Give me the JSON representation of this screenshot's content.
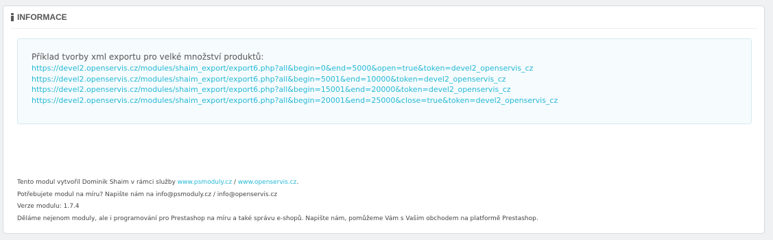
{
  "panel": {
    "heading": "INFORMACE",
    "icon": "info-icon"
  },
  "alert": {
    "title": "Příklad tvorby xml exportu pro velké množství produktů:",
    "links": [
      "https://devel2.openservis.cz/modules/shaim_export/export6.php?all&begin=0&end=5000&open=true&token=devel2_openservis_cz",
      "https://devel2.openservis.cz/modules/shaim_export/export6.php?all&begin=5001&end=10000&token=devel2_openservis_cz",
      "https://devel2.openservis.cz/modules/shaim_export/export6.php?all&begin=15001&end=20000&token=devel2_openservis_cz",
      "https://devel2.openservis.cz/modules/shaim_export/export6.php?all&begin=20001&end=25000&close=true&token=devel2_openservis_cz"
    ]
  },
  "footer": {
    "credit_prefix": "Tento modul vytvořil Dominik Shaim v rámci služby ",
    "link1": "www.psmoduly.cz",
    "separator": " / ",
    "link2": "www.openservis.cz",
    "credit_suffix": ".",
    "contact": "Potřebujete modul na míru? Napište nám na info@psmoduly.cz / info@openservis.cz",
    "version": "Verze modulu: 1.7.4",
    "promo": "Děláme nejenom moduly, ale i programování pro Prestashop na míru a také správu e-shopů. Napište nám, pomůžeme Vám s Vašim obchodem na platformě Prestashop."
  },
  "colors": {
    "link": "#25b9d7",
    "alert_bg": "#f6fbfd",
    "alert_border": "#d6e9f1"
  }
}
